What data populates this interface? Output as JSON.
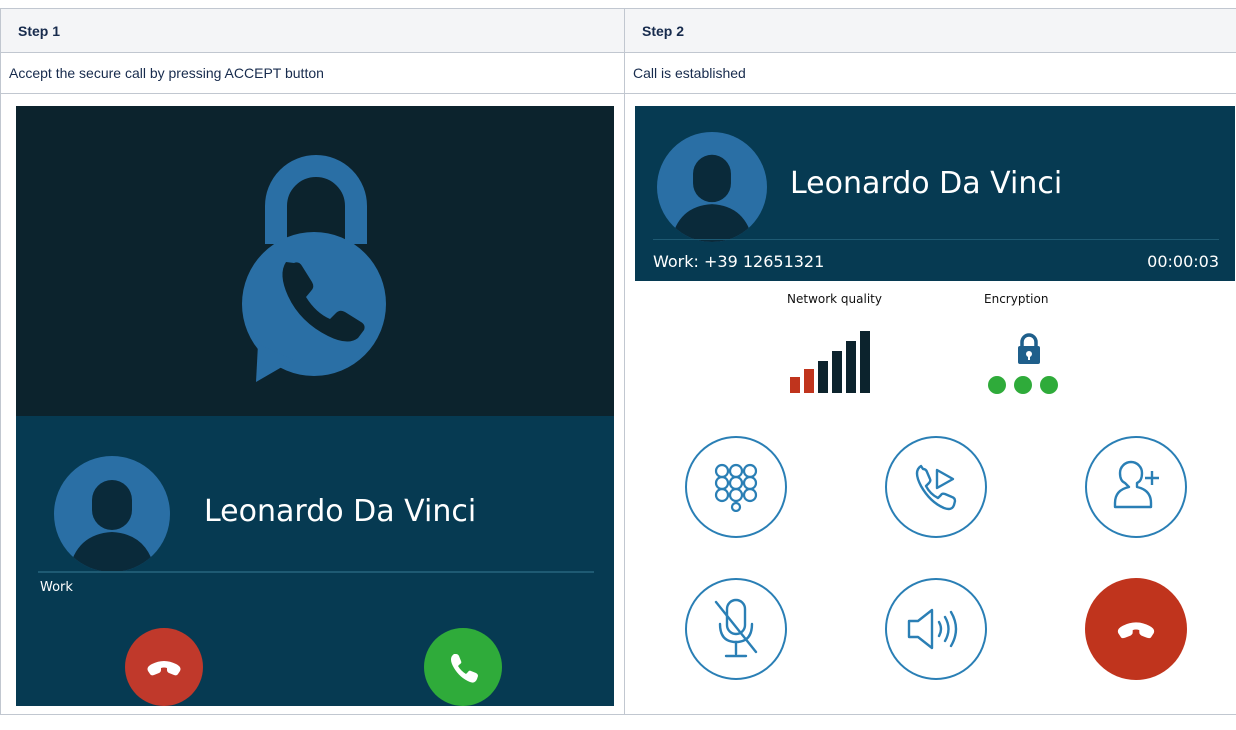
{
  "table": {
    "step1": {
      "header": "Step 1",
      "description": "Accept the secure call by pressing ACCEPT button",
      "screen": {
        "caller_name": "Leonardo Da Vinci",
        "line_label": "Work",
        "reject_icon": "hangup-icon",
        "accept_icon": "phone-icon",
        "colors": {
          "top_bg": "#0c232d",
          "panel_bg": "#063a52",
          "lock": "#2a6fa5",
          "reject": "#c0392b",
          "accept": "#2fab3a"
        }
      }
    },
    "step2": {
      "header": "Step 2",
      "description": "Call is established",
      "screen": {
        "caller_name": "Leonardo Da Vinci",
        "number_line": "Work: +39 12651321",
        "duration": "00:00:03",
        "network_quality_label": "Network quality",
        "encryption_label": "Encryption",
        "signal_bars": [
          "red",
          "red",
          "dark",
          "dark",
          "dark",
          "dark"
        ],
        "encryption_dots": 3,
        "controls": [
          "dialpad-icon",
          "transfer-call-icon",
          "add-contact-icon",
          "mute-icon",
          "speaker-icon",
          "hangup-icon"
        ],
        "colors": {
          "header_bg": "#063a52",
          "accent": "#2a7fb5",
          "end_call": "#c0341d",
          "encryption_ok": "#2fab3a"
        }
      }
    }
  }
}
